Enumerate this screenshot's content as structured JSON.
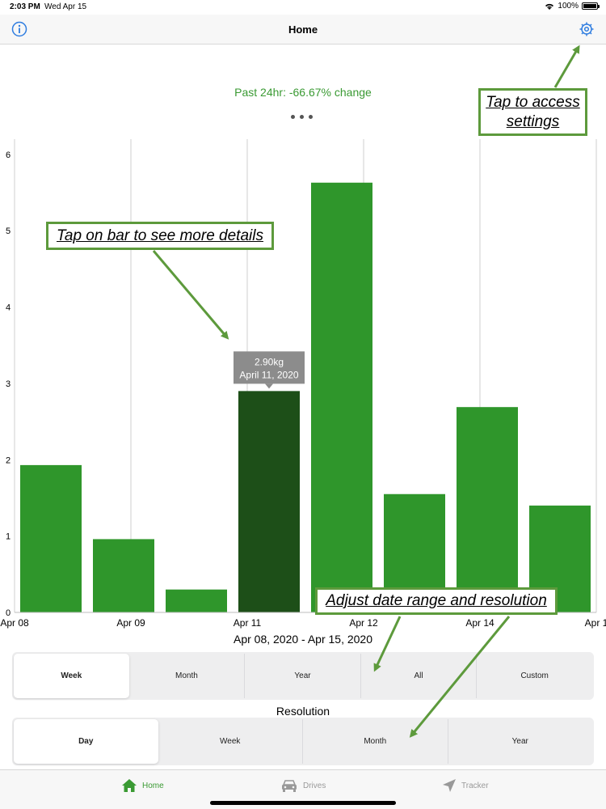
{
  "status_bar": {
    "time": "2:03 PM",
    "date": "Wed Apr 15",
    "battery": "100%"
  },
  "nav": {
    "title": "Home",
    "left_icon": "info-icon",
    "right_icon": "gear-icon"
  },
  "summary": {
    "change_text": "Past 24hr: -66.67% change"
  },
  "colors": {
    "bar": "#2f962b",
    "bar_selected": "#1d4f18",
    "accent": "#3a9a33",
    "annotation_border": "#5d9a3c",
    "tooltip": "#8c8c8c"
  },
  "chart_data": {
    "type": "bar",
    "values": [
      1.93,
      0.96,
      0.3,
      2.9,
      5.63,
      1.55,
      2.69,
      1.4
    ],
    "ylim": [
      0,
      6.2
    ],
    "yticks": [
      "0",
      "1",
      "2",
      "3",
      "4",
      "5",
      "6"
    ],
    "yticks_values": [
      0,
      1,
      2,
      3,
      4,
      5,
      6
    ],
    "xtick_labels": [
      "Apr 08",
      "Apr 09",
      "Apr 11",
      "Apr 12",
      "Apr 14",
      "Apr 1"
    ],
    "selected_index": 3,
    "tooltip": {
      "value": "2.90kg",
      "date": "April 11, 2020"
    }
  },
  "date_range": "Apr 08, 2020 - Apr 15, 2020",
  "range_options": [
    {
      "label": "Week",
      "selected": true
    },
    {
      "label": "Month",
      "selected": false
    },
    {
      "label": "Year",
      "selected": false
    },
    {
      "label": "All",
      "selected": false
    },
    {
      "label": "Custom",
      "selected": false
    }
  ],
  "resolution_label": "Resolution",
  "resolution_options": [
    {
      "label": "Day",
      "selected": true
    },
    {
      "label": "Week",
      "selected": false
    },
    {
      "label": "Month",
      "selected": false
    },
    {
      "label": "Year",
      "selected": false
    }
  ],
  "tabs": [
    {
      "label": "Home",
      "icon": "home-icon",
      "active": true
    },
    {
      "label": "Drives",
      "icon": "car-icon",
      "active": false
    },
    {
      "label": "Tracker",
      "icon": "location-arrow-icon",
      "active": false
    }
  ],
  "annotations": {
    "settings": "Tap to access settings",
    "bar": "Tap on bar to see more details",
    "range": "Adjust date range and resolution"
  }
}
